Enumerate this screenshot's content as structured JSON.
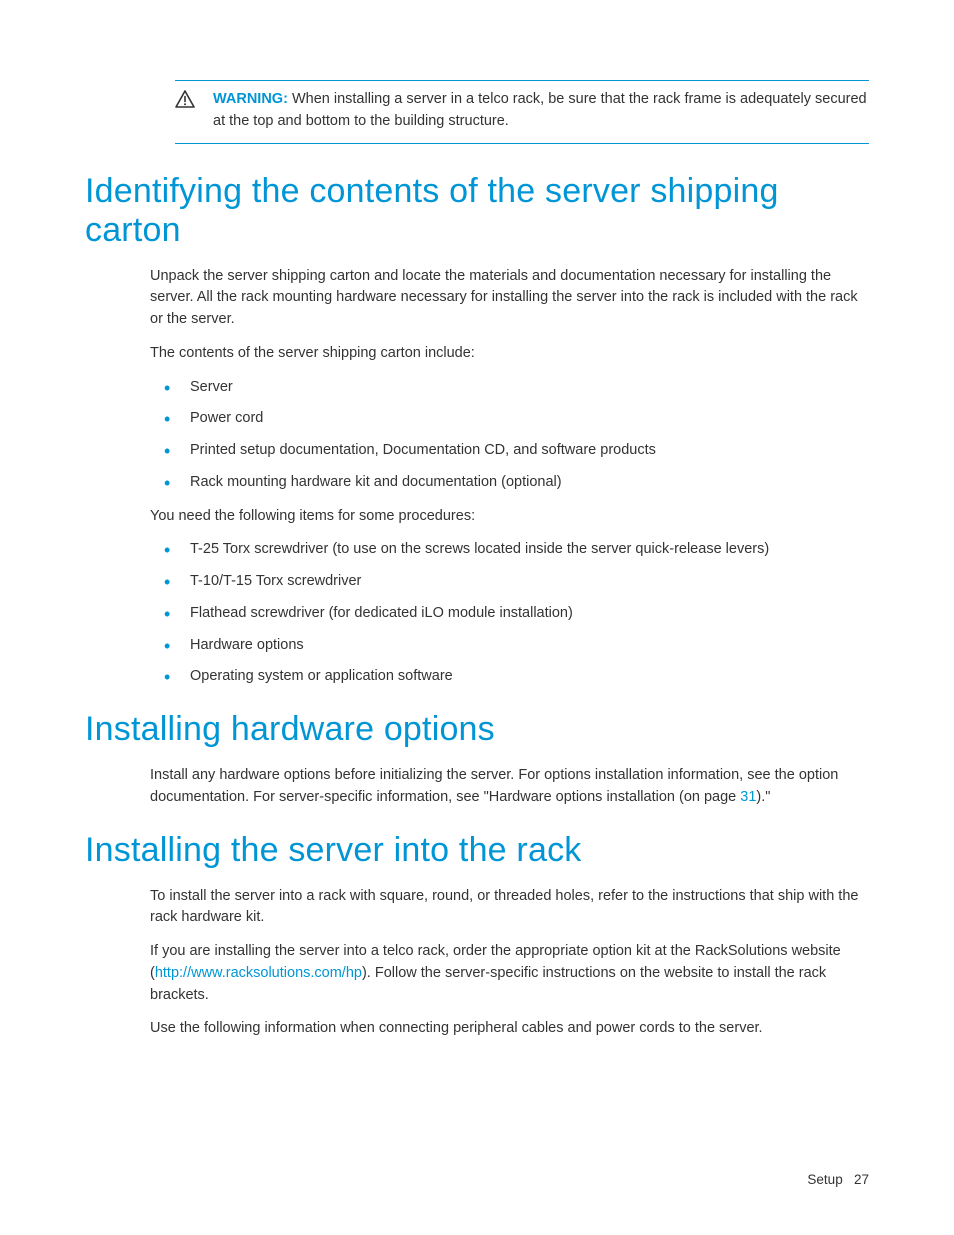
{
  "warning": {
    "label": "WARNING:",
    "text": "When installing a server in a telco rack, be sure that the rack frame is adequately secured at the top and bottom to the building structure."
  },
  "section1": {
    "heading": "Identifying the contents of the server shipping carton",
    "p1": "Unpack the server shipping carton and locate the materials and documentation necessary for installing the server. All the rack mounting hardware necessary for installing the server into the rack is included with the rack or the server.",
    "p2": "The contents of the server shipping carton include:",
    "list1": {
      "i0": "Server",
      "i1": "Power cord",
      "i2": "Printed setup documentation, Documentation CD, and software products",
      "i3": "Rack mounting hardware kit and documentation (optional)"
    },
    "p3": "You need the following items for some procedures:",
    "list2": {
      "i0": "T-25 Torx screwdriver (to use on the screws located inside the server quick-release levers)",
      "i1": "T-10/T-15 Torx screwdriver",
      "i2": "Flathead screwdriver (for dedicated iLO module installation)",
      "i3": "Hardware options",
      "i4": "Operating system or application software"
    }
  },
  "section2": {
    "heading": "Installing hardware options",
    "p1_a": "Install any hardware options before initializing the server. For options installation information, see the option documentation. For server-specific information, see \"Hardware options installation (on page ",
    "p1_link": "31",
    "p1_b": ").\""
  },
  "section3": {
    "heading": "Installing the server into the rack",
    "p1": "To install the server into a rack with square, round, or threaded holes, refer to the instructions that ship with the rack hardware kit.",
    "p2_a": "If you are installing the server into a telco rack, order the appropriate option kit at the RackSolutions website (",
    "p2_link": "http://www.racksolutions.com/hp",
    "p2_b": "). Follow the server-specific instructions on the website to install the rack brackets.",
    "p3": "Use the following information when connecting peripheral cables and power cords to the server."
  },
  "footer": {
    "section": "Setup",
    "page": "27"
  }
}
